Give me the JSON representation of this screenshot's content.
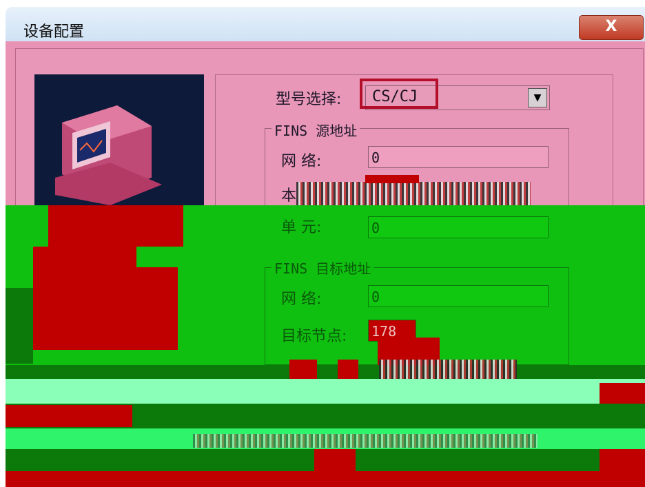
{
  "window": {
    "title": "设备配置",
    "close_label": "X"
  },
  "model": {
    "label": "型号选择:",
    "value": "CS/CJ"
  },
  "fins_source": {
    "legend": "FINS 源地址",
    "network_label": "网    络:",
    "network_value": "0",
    "node_label_partial": "本",
    "unit_label": "单    元:",
    "unit_value": "0"
  },
  "fins_target": {
    "legend": "FINS 目标地址",
    "network_label": "网    络:",
    "network_value": "0",
    "node_label": "目标节点:",
    "node_value": "178"
  },
  "colors": {
    "dialog_pink": "#e893b4",
    "corrupt_green": "#10c010",
    "corrupt_red": "#c00000",
    "highlight_red": "#b30e2a"
  }
}
